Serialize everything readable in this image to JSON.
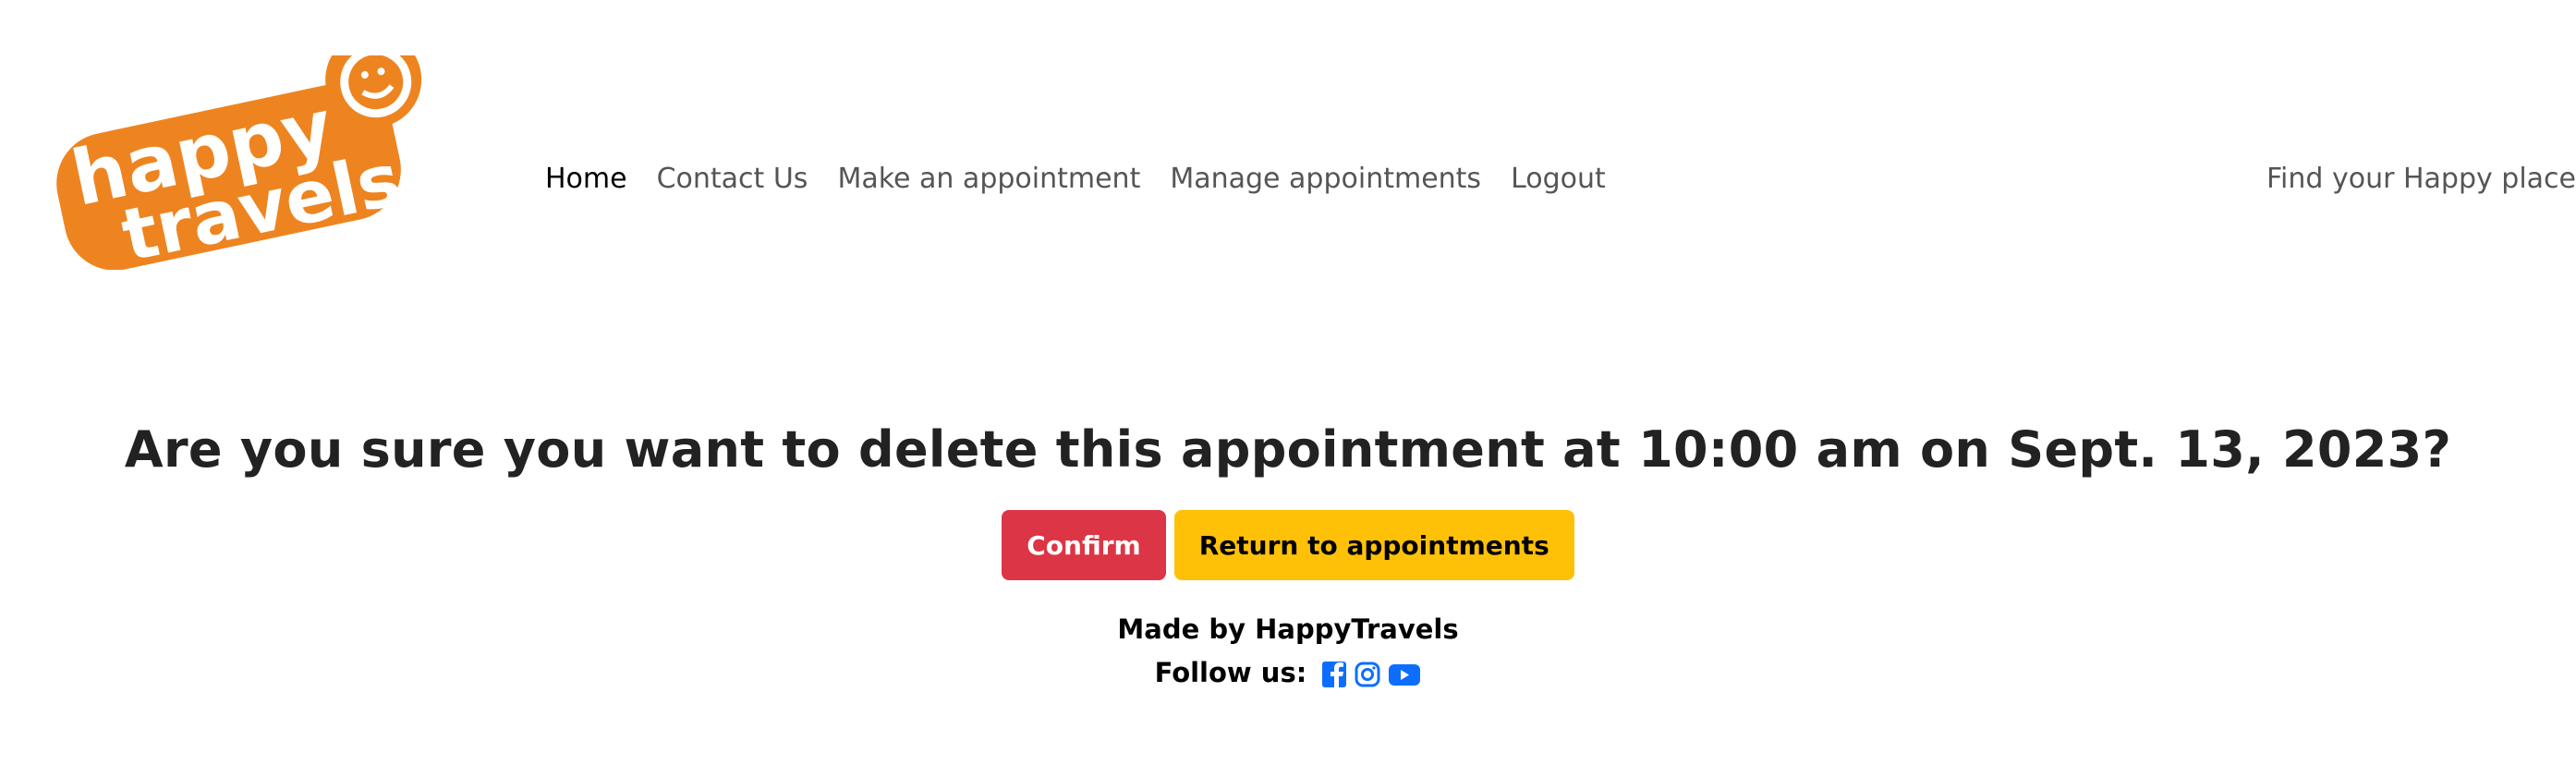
{
  "brand": {
    "logo_text_line1": "happy",
    "logo_text_line2": "travels",
    "logo_color": "#ee8420"
  },
  "nav": {
    "items": [
      {
        "label": "Home",
        "active": true
      },
      {
        "label": "Contact Us"
      },
      {
        "label": "Make an appointment"
      },
      {
        "label": "Manage appointments"
      },
      {
        "label": "Logout"
      }
    ]
  },
  "tagline": "Find your Happy place",
  "main": {
    "question": "Are you sure you want to delete this appointment at 10:00 am on Sept. 13, 2023?",
    "confirm_label": "Confirm",
    "return_label": "Return to appointments",
    "confirm_color": "#dc3545",
    "return_color": "#ffc107"
  },
  "footer": {
    "made_by": "Made by HappyTravels",
    "follow": "Follow us:",
    "social_icons": [
      "facebook-icon",
      "instagram-icon",
      "youtube-icon"
    ],
    "icon_color": "#0d6efd"
  }
}
